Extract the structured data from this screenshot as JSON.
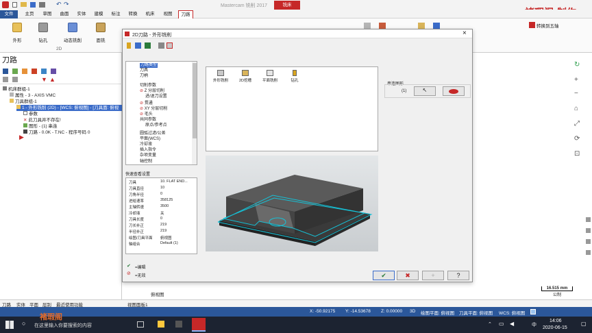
{
  "app": {
    "title": "Mastercam 铣削 2017",
    "context_tab": "铣床"
  },
  "watermark": "褚瑕阁 制作",
  "ribbon_tabs": [
    "文件",
    "主页",
    "草图",
    "曲面",
    "实体",
    "建模",
    "标注",
    "转换",
    "机床",
    "视图",
    "刀路"
  ],
  "ribbon": {
    "buttons": [
      "外形",
      "钻孔",
      "动态铣削",
      "面铣"
    ],
    "group_label": "2D",
    "right_button": "转换到五轴"
  },
  "toolpath_panel": {
    "title": "刀路",
    "tree": [
      {
        "text": "机床群组-1",
        "indent": 0
      },
      {
        "text": "属性 - 3 - AXIS VMC",
        "indent": 1
      },
      {
        "text": "刀具群组-1",
        "indent": 1
      },
      {
        "text": "1 - 外形铣削 (2D) - [WCS: 俯视图] - [刀具面: 俯视",
        "indent": 2,
        "selected": true
      },
      {
        "text": "参数",
        "indent": 3
      },
      {
        "text": "此刀具并不存在!",
        "indent": 3
      },
      {
        "text": "图形 - (1) 串连",
        "indent": 3
      },
      {
        "text": "刀路 - 0.0K - T.NC - 程序号码 0",
        "indent": 3
      }
    ]
  },
  "bottom_tabs": [
    "刀路",
    "实体",
    "平面",
    "层别",
    "最近使用功能"
  ],
  "graphics": {
    "view_label": "俯视图",
    "view_tab": "视图面板1",
    "scale": "16.515 mm",
    "scale_unit": "公制"
  },
  "status_bar": {
    "x": "X:  -50.92175",
    "y": "Y:  -14.53678",
    "z": "Z:  0.00000",
    "dim": "3D",
    "cplane": "绘图平面: 俯视图",
    "tplane": "刀具平面: 俯视图",
    "wcs": "WCS: 俯视图"
  },
  "taskbar": {
    "search_placeholder": "在这里输入你要搜索的内容",
    "time": "14:06",
    "date": "2020-06-15",
    "ime": "中",
    "logo_text": "褚瑕阁"
  },
  "dialog": {
    "title": "2D刀路 - 外形铣削",
    "nav_tree": [
      "刀路类型",
      "刀具",
      "刀柄",
      "切削参数",
      "Z 分层切削",
      "进/退刀设置",
      "贯通",
      "XY 分层切削",
      "毛头",
      "共同参数",
      "原点/参考点",
      "圆弧过滤/公差",
      "平面(WCS)",
      "冷却液",
      "插入指令",
      "杂项变量",
      "轴控制"
    ],
    "toolpath_types": [
      "外形铣削",
      "2D挖槽",
      "平面铣削",
      "钻孔"
    ],
    "chain_label": "串连图形",
    "chain_count": "(1)",
    "quick_view_title": "快速查看设置",
    "quick_view": [
      {
        "k": "刀具",
        "v": "10. FLAT END..."
      },
      {
        "k": "刀具直径",
        "v": "10"
      },
      {
        "k": "刀角半径",
        "v": "0"
      },
      {
        "k": "进给速率",
        "v": "358125"
      },
      {
        "k": "主轴转速",
        "v": "3500"
      },
      {
        "k": "冷却液",
        "v": "关"
      },
      {
        "k": "刀具长度",
        "v": "0"
      },
      {
        "k": "刀长补正",
        "v": "219"
      },
      {
        "k": "半径补正",
        "v": "219"
      },
      {
        "k": "绘图/刀具平面",
        "v": "俯视图"
      },
      {
        "k": "轴组合",
        "v": "Default (1)"
      }
    ],
    "legend_edit": "=编辑",
    "legend_disabled": "=无效",
    "buttons": {
      "ok": "✔",
      "cancel": "✖",
      "add": "+",
      "help": "?"
    }
  },
  "colors": {
    "accent": "#2b579a",
    "title_red": "#c62828",
    "part": "#4a4a4a",
    "toolpath": "#16c1d6"
  }
}
